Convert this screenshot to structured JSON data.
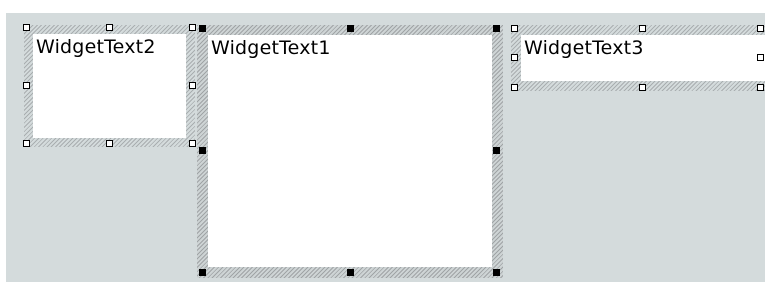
{
  "designer": {
    "widgets": [
      {
        "id": "widget-text-2",
        "label": "WidgetText2",
        "selected": false
      },
      {
        "id": "widget-text-1",
        "label": "WidgetText1",
        "selected": true
      },
      {
        "id": "widget-text-3",
        "label": "WidgetText3",
        "selected": false
      }
    ]
  }
}
